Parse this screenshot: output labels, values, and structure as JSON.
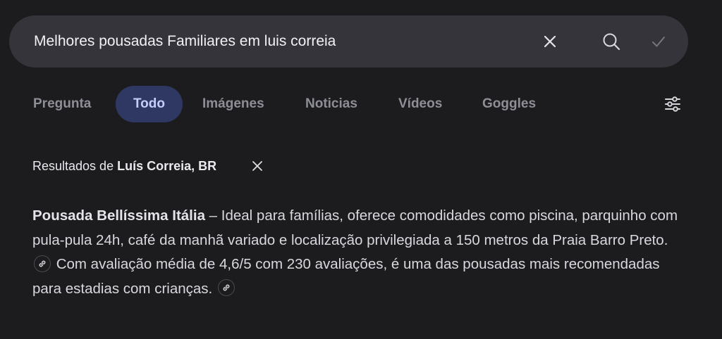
{
  "search": {
    "query": "Melhores pousadas Familiares em luis correia"
  },
  "tabs": [
    {
      "label": "Pregunta",
      "active": false
    },
    {
      "label": "Todo",
      "active": true
    },
    {
      "label": "Imágenes",
      "active": false
    },
    {
      "label": "Noticias",
      "active": false
    },
    {
      "label": "Vídeos",
      "active": false
    },
    {
      "label": "Goggles",
      "active": false
    }
  ],
  "location": {
    "prefix": "Resultados de ",
    "name": "Luís Correia, BR"
  },
  "answer": {
    "title": "Pousada Bellíssima Itália",
    "part1": " – Ideal para famílias, oferece comodidades como piscina, parquinho com pula-pula 24h, café da manhã variado e localização privilegiada a 150 metros da Praia Barro Preto. ",
    "part2": " Com avaliação média de 4,6/5 com 230 avaliações, é uma das pousadas mais recomendadas para estadias com crianças. "
  },
  "icons": {
    "clear": "close-icon",
    "search": "search-icon",
    "submit": "check-icon",
    "filters": "sliders-icon",
    "citation": "link-icon"
  },
  "colors": {
    "background": "#1c1c1f",
    "search_bar": "#34343a",
    "active_tab_bg": "#2e3863",
    "active_tab_text": "#c5cdfb",
    "inactive_tab_text": "#8e8e96"
  }
}
